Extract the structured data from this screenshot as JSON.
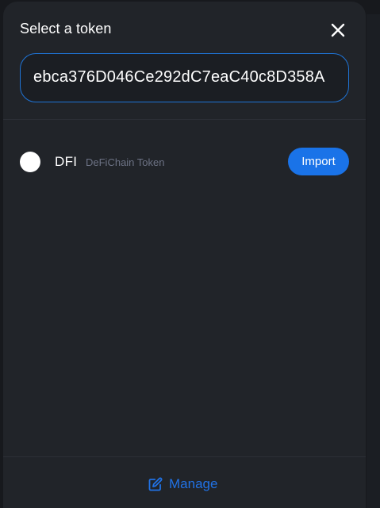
{
  "modal": {
    "title": "Select a token"
  },
  "search": {
    "value": "ebca376D046Ce292dC7eaC40c8D358A"
  },
  "token": {
    "symbol": "DFI",
    "name": "DeFiChain Token",
    "action_label": "Import"
  },
  "footer": {
    "manage_label": "Manage"
  },
  "colors": {
    "accent": "#1a73e8",
    "modal_bg": "#212429",
    "page_bg": "#17191d",
    "link": "#2172e5"
  },
  "icons": {
    "close": "close-icon",
    "manage": "edit-icon"
  }
}
